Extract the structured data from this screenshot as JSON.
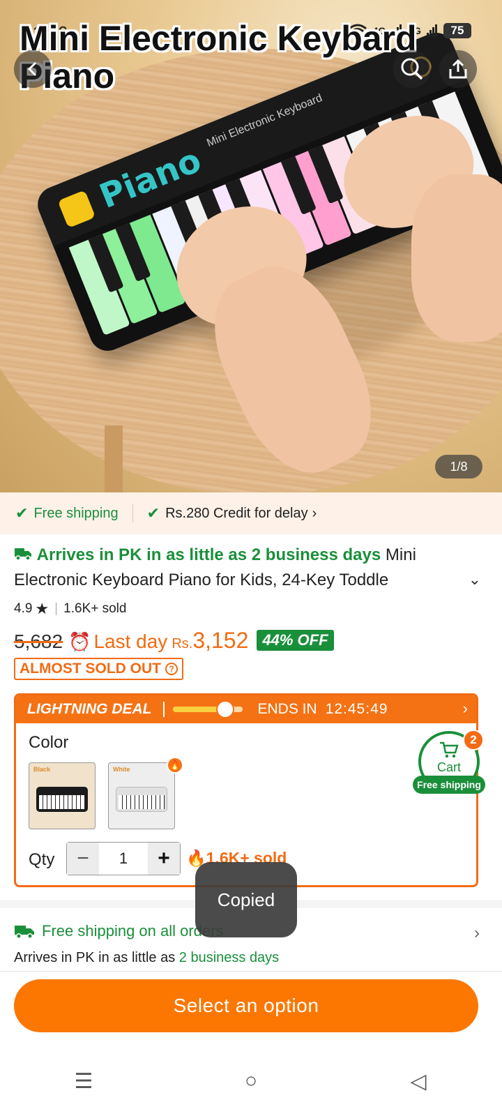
{
  "status_bar": {
    "time": "11:16",
    "network_1": "4G",
    "network_2": "4G",
    "battery": "75"
  },
  "hero": {
    "overlay_title": "Mini Electronic Keybard Piano",
    "piano_brand": "Piano",
    "piano_subtitle": "Mini Electronic Keyboard",
    "image_counter": "1/8",
    "icons": {
      "back": "chevron-left-icon",
      "search": "search-icon",
      "share": "share-icon"
    }
  },
  "benefits": {
    "free_shipping": "Free shipping",
    "credit": "Rs.280 Credit for delay",
    "credit_chevron": "›"
  },
  "product": {
    "arrives_text": "Arrives in PK in as little as 2 business days",
    "title": "Mini Electronic Keyboard Piano for Kids, 24-Key Toddle",
    "expand_icon": "⌄",
    "rating": "4.9",
    "star": "★",
    "sold": "1.6K+ sold",
    "old_price": "5,682",
    "last_day": "Last day",
    "currency": "Rs.",
    "price": "3,152",
    "discount": "44% OFF",
    "stock_status": "ALMOST SOLD OUT",
    "stock_help": "?"
  },
  "deal": {
    "label": "LIGHTNING DEAL",
    "progress_fraction": 0.75,
    "ends_label": "ENDS IN",
    "timer": "12:45:49",
    "arrow": "›",
    "color_label": "Color",
    "swatches": [
      {
        "tag": "Black",
        "body_color": "#1b1b1b",
        "selected": true
      },
      {
        "tag": "White",
        "body_color": "#e8e8e8",
        "selected": false
      }
    ],
    "qty_label": "Qty",
    "qty_minus": "−",
    "qty_value": "1",
    "qty_plus": "+",
    "qty_sold": "1.6K+ sold"
  },
  "cart": {
    "label": "Cart",
    "count": "2",
    "ship_badge": "Free shipping"
  },
  "shipping": {
    "title": "Free shipping on all orders",
    "arrive_prefix": "Arrives in PK in as little as",
    "arrive_days": "2 business days",
    "chevron": "›"
  },
  "toast": {
    "text": "Copied"
  },
  "cta": {
    "label": "Select an option"
  },
  "nav": {
    "recents": "☰",
    "home": "○",
    "back": "◁"
  },
  "colors": {
    "accent_orange": "#fb7701",
    "deal_orange": "#f57214",
    "green": "#1a8f3a"
  }
}
